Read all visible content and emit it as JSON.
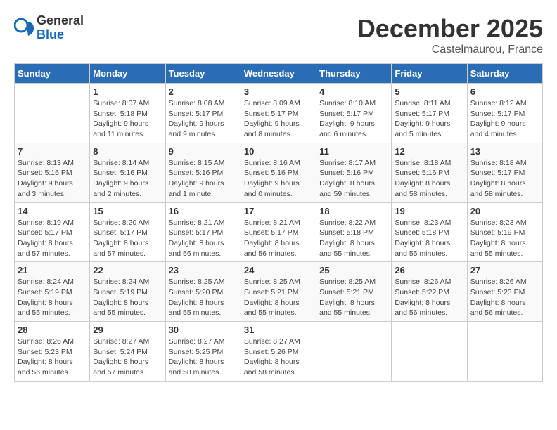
{
  "header": {
    "logo_general": "General",
    "logo_blue": "Blue",
    "month_title": "December 2025",
    "location": "Castelmaurou, France"
  },
  "days_of_week": [
    "Sunday",
    "Monday",
    "Tuesday",
    "Wednesday",
    "Thursday",
    "Friday",
    "Saturday"
  ],
  "weeks": [
    [
      {
        "day": "",
        "info": ""
      },
      {
        "day": "1",
        "info": "Sunrise: 8:07 AM\nSunset: 5:18 PM\nDaylight: 9 hours\nand 11 minutes."
      },
      {
        "day": "2",
        "info": "Sunrise: 8:08 AM\nSunset: 5:17 PM\nDaylight: 9 hours\nand 9 minutes."
      },
      {
        "day": "3",
        "info": "Sunrise: 8:09 AM\nSunset: 5:17 PM\nDaylight: 9 hours\nand 8 minutes."
      },
      {
        "day": "4",
        "info": "Sunrise: 8:10 AM\nSunset: 5:17 PM\nDaylight: 9 hours\nand 6 minutes."
      },
      {
        "day": "5",
        "info": "Sunrise: 8:11 AM\nSunset: 5:17 PM\nDaylight: 9 hours\nand 5 minutes."
      },
      {
        "day": "6",
        "info": "Sunrise: 8:12 AM\nSunset: 5:17 PM\nDaylight: 9 hours\nand 4 minutes."
      }
    ],
    [
      {
        "day": "7",
        "info": "Sunrise: 8:13 AM\nSunset: 5:16 PM\nDaylight: 9 hours\nand 3 minutes."
      },
      {
        "day": "8",
        "info": "Sunrise: 8:14 AM\nSunset: 5:16 PM\nDaylight: 9 hours\nand 2 minutes."
      },
      {
        "day": "9",
        "info": "Sunrise: 8:15 AM\nSunset: 5:16 PM\nDaylight: 9 hours\nand 1 minute."
      },
      {
        "day": "10",
        "info": "Sunrise: 8:16 AM\nSunset: 5:16 PM\nDaylight: 9 hours\nand 0 minutes."
      },
      {
        "day": "11",
        "info": "Sunrise: 8:17 AM\nSunset: 5:16 PM\nDaylight: 8 hours\nand 59 minutes."
      },
      {
        "day": "12",
        "info": "Sunrise: 8:18 AM\nSunset: 5:16 PM\nDaylight: 8 hours\nand 58 minutes."
      },
      {
        "day": "13",
        "info": "Sunrise: 8:18 AM\nSunset: 5:17 PM\nDaylight: 8 hours\nand 58 minutes."
      }
    ],
    [
      {
        "day": "14",
        "info": "Sunrise: 8:19 AM\nSunset: 5:17 PM\nDaylight: 8 hours\nand 57 minutes."
      },
      {
        "day": "15",
        "info": "Sunrise: 8:20 AM\nSunset: 5:17 PM\nDaylight: 8 hours\nand 57 minutes."
      },
      {
        "day": "16",
        "info": "Sunrise: 8:21 AM\nSunset: 5:17 PM\nDaylight: 8 hours\nand 56 minutes."
      },
      {
        "day": "17",
        "info": "Sunrise: 8:21 AM\nSunset: 5:17 PM\nDaylight: 8 hours\nand 56 minutes."
      },
      {
        "day": "18",
        "info": "Sunrise: 8:22 AM\nSunset: 5:18 PM\nDaylight: 8 hours\nand 55 minutes."
      },
      {
        "day": "19",
        "info": "Sunrise: 8:23 AM\nSunset: 5:18 PM\nDaylight: 8 hours\nand 55 minutes."
      },
      {
        "day": "20",
        "info": "Sunrise: 8:23 AM\nSunset: 5:19 PM\nDaylight: 8 hours\nand 55 minutes."
      }
    ],
    [
      {
        "day": "21",
        "info": "Sunrise: 8:24 AM\nSunset: 5:19 PM\nDaylight: 8 hours\nand 55 minutes."
      },
      {
        "day": "22",
        "info": "Sunrise: 8:24 AM\nSunset: 5:19 PM\nDaylight: 8 hours\nand 55 minutes."
      },
      {
        "day": "23",
        "info": "Sunrise: 8:25 AM\nSunset: 5:20 PM\nDaylight: 8 hours\nand 55 minutes."
      },
      {
        "day": "24",
        "info": "Sunrise: 8:25 AM\nSunset: 5:21 PM\nDaylight: 8 hours\nand 55 minutes."
      },
      {
        "day": "25",
        "info": "Sunrise: 8:25 AM\nSunset: 5:21 PM\nDaylight: 8 hours\nand 55 minutes."
      },
      {
        "day": "26",
        "info": "Sunrise: 8:26 AM\nSunset: 5:22 PM\nDaylight: 8 hours\nand 56 minutes."
      },
      {
        "day": "27",
        "info": "Sunrise: 8:26 AM\nSunset: 5:23 PM\nDaylight: 8 hours\nand 56 minutes."
      }
    ],
    [
      {
        "day": "28",
        "info": "Sunrise: 8:26 AM\nSunset: 5:23 PM\nDaylight: 8 hours\nand 56 minutes."
      },
      {
        "day": "29",
        "info": "Sunrise: 8:27 AM\nSunset: 5:24 PM\nDaylight: 8 hours\nand 57 minutes."
      },
      {
        "day": "30",
        "info": "Sunrise: 8:27 AM\nSunset: 5:25 PM\nDaylight: 8 hours\nand 58 minutes."
      },
      {
        "day": "31",
        "info": "Sunrise: 8:27 AM\nSunset: 5:26 PM\nDaylight: 8 hours\nand 58 minutes."
      },
      {
        "day": "",
        "info": ""
      },
      {
        "day": "",
        "info": ""
      },
      {
        "day": "",
        "info": ""
      }
    ]
  ]
}
